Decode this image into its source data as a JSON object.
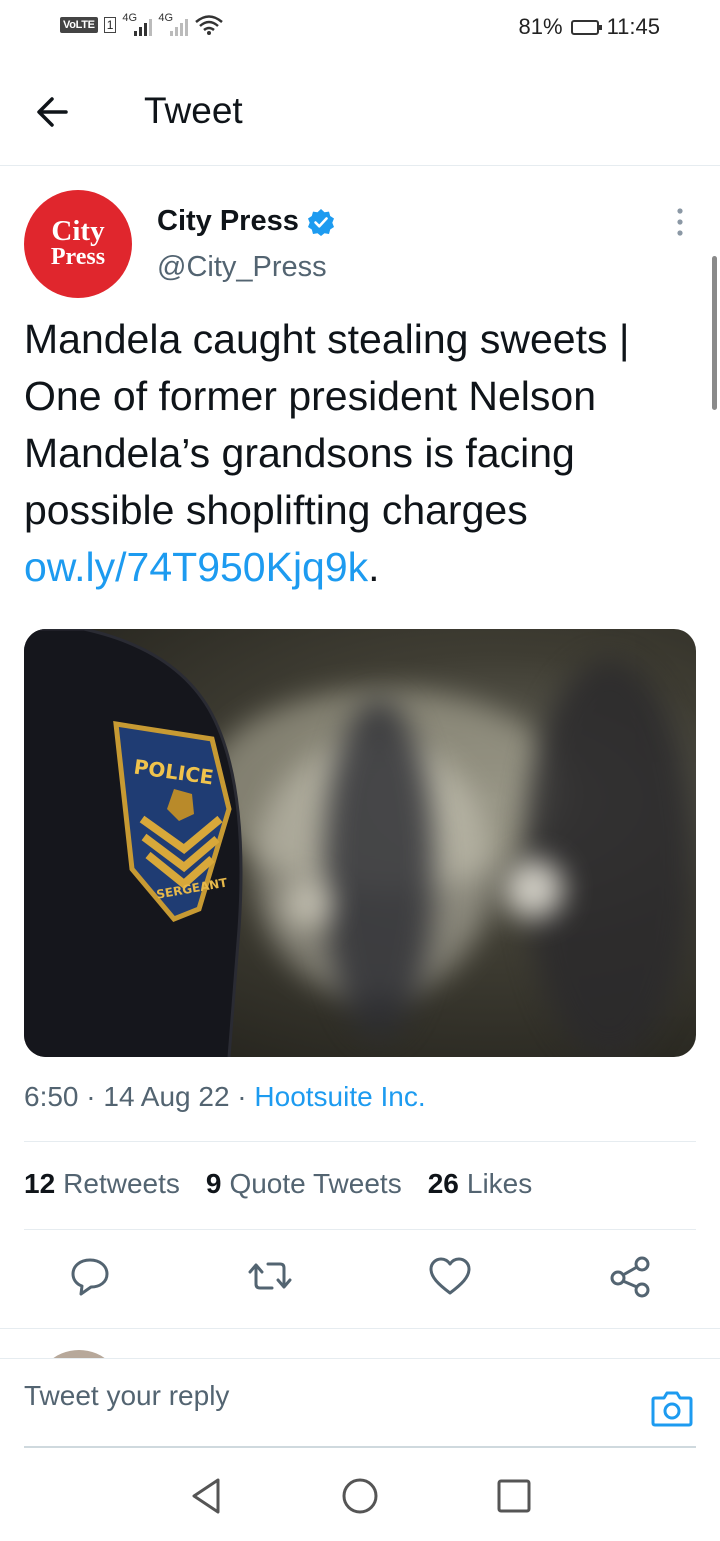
{
  "status_bar": {
    "volte": "VoLTE",
    "sim_slot": "1",
    "network_1": "4G",
    "network_2": "4G",
    "battery_percent": "81%",
    "battery_level": 0.81,
    "time": "11:45"
  },
  "header": {
    "back_icon": "arrow-left-icon",
    "title": "Tweet"
  },
  "tweet": {
    "avatar": {
      "line1": "City",
      "line2": "Press",
      "color": "#e0262d"
    },
    "author_name": "City Press",
    "verified_icon": "verified-badge-icon",
    "handle": "@City_Press",
    "more_icon": "more-vertical-icon",
    "text": "Mandela caught stealing sweets | One of former president Nelson Mandela’s grandsons is facing possible shoplifting charges ",
    "link": "ow.ly/74T950Kjq9k",
    "text_end": ".",
    "image_patch": {
      "top": "POLICE",
      "bottom": "SERGEANT"
    },
    "time": "6:50",
    "separator": "·",
    "date": "14 Aug 22",
    "source": "Hootsuite Inc.",
    "stats": {
      "retweets_count": "12",
      "retweets_label": "Retweets",
      "quotes_count": "9",
      "quotes_label": "Quote Tweets",
      "likes_count": "26",
      "likes_label": "Likes"
    },
    "actions": [
      "reply-icon",
      "retweet-icon",
      "like-icon",
      "share-icon"
    ]
  },
  "reply": {
    "placeholder": "Tweet your reply",
    "camera_icon": "camera-icon"
  },
  "nav": [
    "back-triangle-icon",
    "home-circle-icon",
    "recents-square-icon"
  ],
  "colors": {
    "link": "#1d9bf0",
    "secondary_text": "#536471",
    "divider": "#e6ecf0"
  }
}
